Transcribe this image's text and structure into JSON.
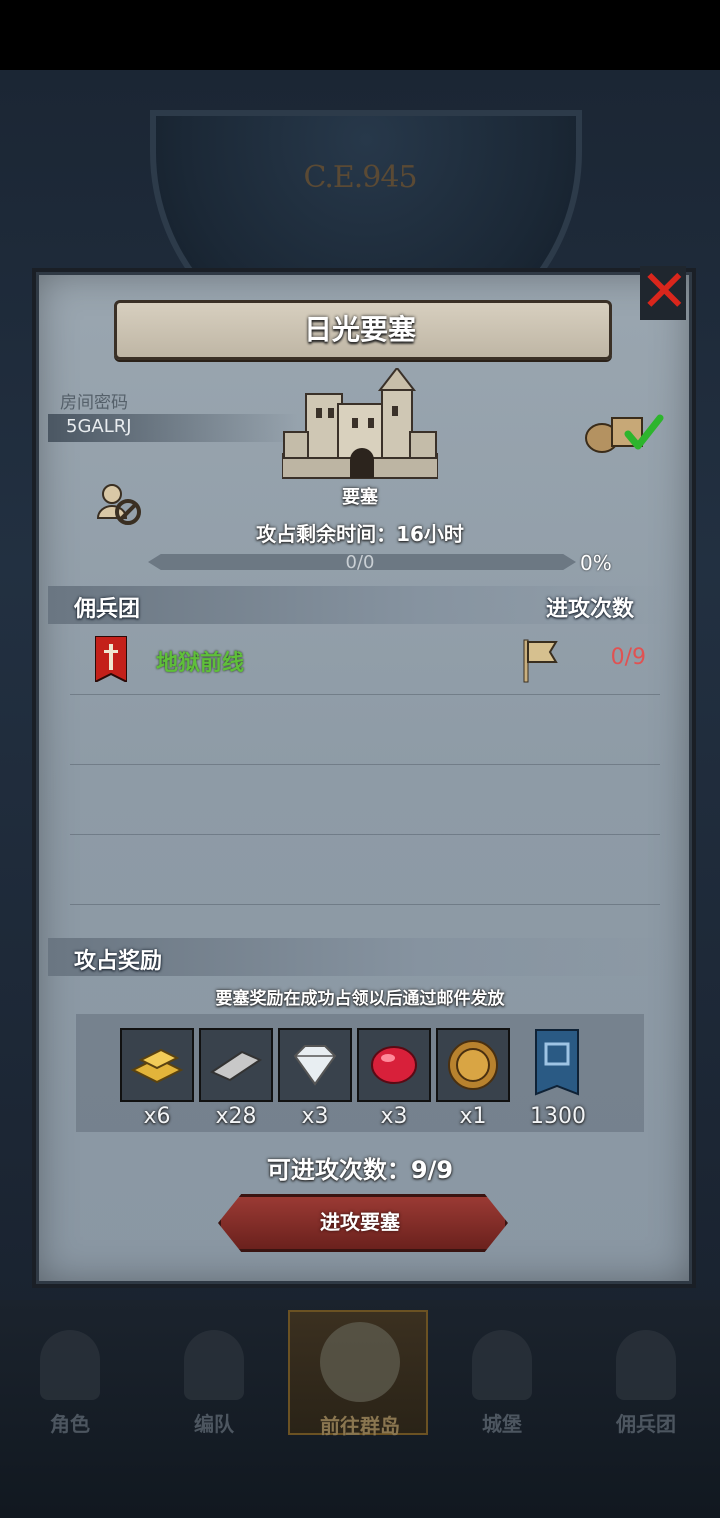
{
  "background": {
    "clock_year": "C.E.945"
  },
  "dialog": {
    "title": "日光要塞",
    "room_code_label": "房间密码",
    "room_code": "5GALRJ",
    "building_label": "要塞",
    "time_left": "攻占剩余时间：16小时",
    "progress": {
      "text": "0/0",
      "percent_text": "0%",
      "value": 0
    },
    "guild_section": {
      "title": "佣兵团",
      "attack_count_header": "进攻次数",
      "rows": [
        {
          "name": "地狱前线",
          "count": "0/9"
        }
      ]
    },
    "reward_section": {
      "title": "攻占奖励",
      "note": "要塞奖励在成功占领以后通过邮件发放",
      "items": [
        {
          "icon": "gold-bars-icon",
          "qty": "x6"
        },
        {
          "icon": "silver-ingot-icon",
          "qty": "x28"
        },
        {
          "icon": "diamond-icon",
          "qty": "x3"
        },
        {
          "icon": "ruby-icon",
          "qty": "x3"
        },
        {
          "icon": "helmet-coin-icon",
          "qty": "x1"
        },
        {
          "icon": "fortress-banner-icon",
          "qty": "1300"
        }
      ]
    },
    "attempts": "可进攻次数：9/9",
    "attack_button": "进攻要塞"
  },
  "nav": {
    "tabs": [
      {
        "label": "角色",
        "icon": "knight-icon"
      },
      {
        "label": "编队",
        "icon": "helmet-icon"
      },
      {
        "label": "前往群岛",
        "icon": "island-map-icon",
        "active": true
      },
      {
        "label": "城堡",
        "icon": "castle-icon"
      },
      {
        "label": "佣兵团",
        "icon": "ship-icon"
      }
    ]
  },
  "colors": {
    "accent_gold": "#e0b64a",
    "guild_green": "#5fbf3a",
    "count_red": "#e05252",
    "close_red": "#d9261c"
  }
}
